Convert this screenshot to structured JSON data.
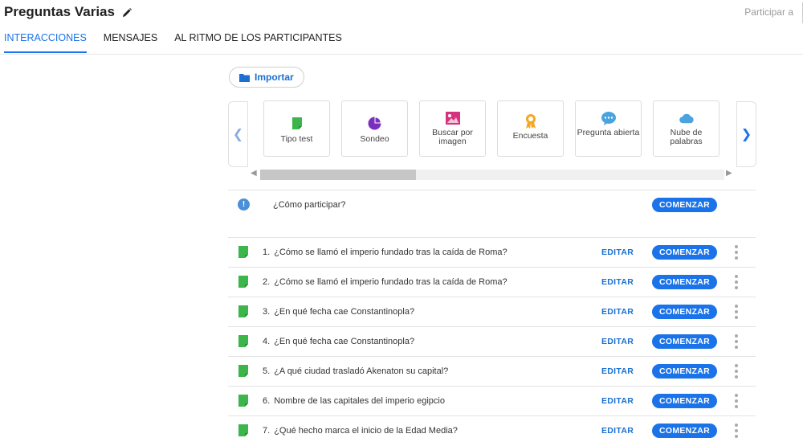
{
  "header": {
    "title": "Preguntas Varias",
    "participar": "Participar a"
  },
  "tabs": [
    {
      "label": "INTERACCIONES",
      "active": true
    },
    {
      "label": "MENSAJES",
      "active": false
    },
    {
      "label": "AL RITMO DE LOS PARTICIPANTES",
      "active": false
    }
  ],
  "import_label": "Importar",
  "cards": [
    {
      "label": "Tipo test",
      "icon": "quiz-icon"
    },
    {
      "label": "Sondeo",
      "icon": "poll-icon"
    },
    {
      "label": "Buscar por imagen",
      "icon": "image-search-icon"
    },
    {
      "label": "Encuesta",
      "icon": "survey-icon"
    },
    {
      "label": "Pregunta abierta",
      "icon": "open-question-icon"
    },
    {
      "label": "Nube de palabras",
      "icon": "word-cloud-icon"
    }
  ],
  "how_to": {
    "text": "¿Cómo participar?",
    "start_label": "COMENZAR"
  },
  "edit_label": "EDITAR",
  "start_label": "COMENZAR",
  "questions": [
    {
      "num": "1.",
      "text": "¿Cómo se llamó el imperio fundado tras la caída de Roma?"
    },
    {
      "num": "2.",
      "text": "¿Cómo se llamó el imperio fundado tras la caída de Roma?"
    },
    {
      "num": "3.",
      "text": "¿En qué fecha cae Constantinopla?"
    },
    {
      "num": "4.",
      "text": "¿En qué fecha cae Constantinopla?"
    },
    {
      "num": "5.",
      "text": "¿A qué ciudad trasladó Akenaton su capital?"
    },
    {
      "num": "6.",
      "text": "Nombre de las capitales del imperio egipcio"
    },
    {
      "num": "7.",
      "text": "¿Qué hecho marca el inicio de la Edad Media?"
    }
  ],
  "colors": {
    "accent": "#1a73e8",
    "quiz_green": "#3cb54a",
    "poll_purple": "#7b2fbe",
    "image_pink": "#d6337e",
    "survey_orange": "#f5a623",
    "chat_blue": "#4aa3df"
  }
}
